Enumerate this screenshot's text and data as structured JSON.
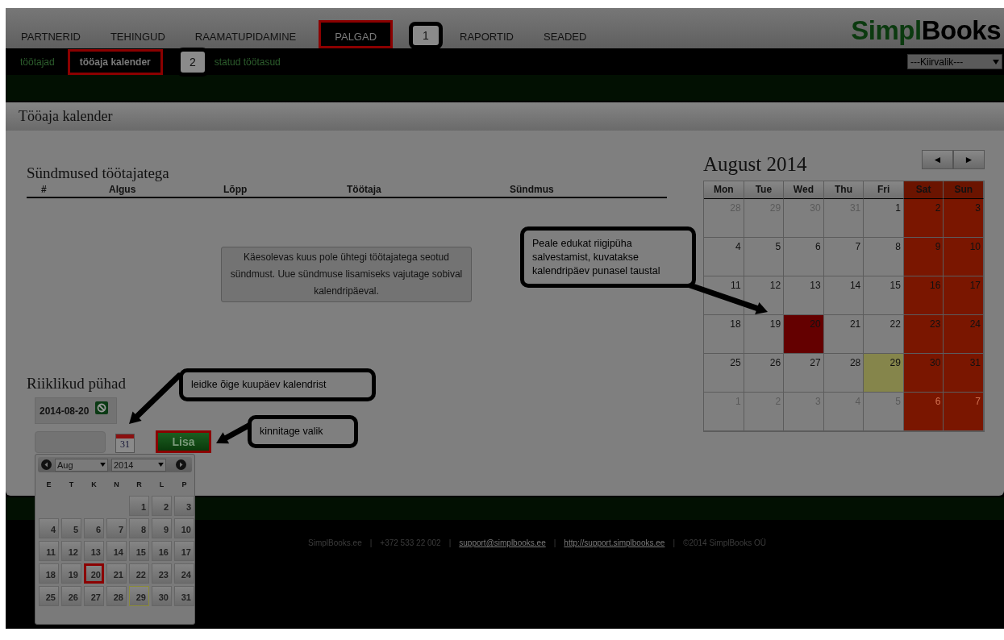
{
  "nav": {
    "items": [
      {
        "label": "PARTNERID",
        "selected": false,
        "highlighted": false
      },
      {
        "label": "TEHINGUD",
        "selected": false,
        "highlighted": false
      },
      {
        "label": "RAAMATUPIDAMINE",
        "selected": false,
        "highlighted": false
      },
      {
        "label": "PALGAD",
        "selected": true,
        "highlighted": true
      },
      {
        "label": "RAPORTID",
        "selected": false,
        "highlighted": false
      },
      {
        "label": "SEADED",
        "selected": false,
        "highlighted": false
      }
    ],
    "logo": [
      "Simpl",
      "Books"
    ]
  },
  "subnav": {
    "items": [
      {
        "label": "töötajad",
        "selected": false,
        "highlighted": false
      },
      {
        "label": "tööaja kalender",
        "selected": true,
        "highlighted": true
      },
      {
        "label": "statud töötasud",
        "selected": false,
        "highlighted": false
      }
    ],
    "quick_select": "---Kiirvalik---"
  },
  "page_title": "Tööaja kalender",
  "events": {
    "title": "Sündmused töötajatega",
    "columns": [
      "#",
      "Algus",
      "Lõpp",
      "Töötaja",
      "Sündmus"
    ],
    "notice": "Käesolevas kuus pole ühtegi töötajatega seotud sündmust. Uue sündmuse lisamiseks vajutage sobival kalendripäeval."
  },
  "holidays": {
    "title": "Riiklikud pühad",
    "dates": [
      "2014-08-20"
    ],
    "add_button": {
      "label": "Lisa",
      "highlighted": true
    },
    "calendar_icon_day": "31"
  },
  "datepicker": {
    "month": "Aug",
    "year": "2014",
    "weekdays": [
      "E",
      "T",
      "K",
      "N",
      "R",
      "L",
      "P"
    ],
    "weeks": [
      [
        {
          "kind": "empty"
        },
        {
          "kind": "empty"
        },
        {
          "kind": "empty"
        },
        {
          "kind": "empty"
        },
        {
          "day": "1",
          "kind": "day"
        },
        {
          "day": "2",
          "kind": "day"
        },
        {
          "day": "3",
          "kind": "day"
        }
      ],
      [
        {
          "day": "4",
          "kind": "day"
        },
        {
          "day": "5",
          "kind": "day"
        },
        {
          "day": "6",
          "kind": "day"
        },
        {
          "day": "7",
          "kind": "day"
        },
        {
          "day": "8",
          "kind": "day"
        },
        {
          "day": "9",
          "kind": "day"
        },
        {
          "day": "10",
          "kind": "day"
        }
      ],
      [
        {
          "day": "11",
          "kind": "day"
        },
        {
          "day": "12",
          "kind": "day"
        },
        {
          "day": "13",
          "kind": "day"
        },
        {
          "day": "14",
          "kind": "day"
        },
        {
          "day": "15",
          "kind": "day"
        },
        {
          "day": "16",
          "kind": "day"
        },
        {
          "day": "17",
          "kind": "day"
        }
      ],
      [
        {
          "day": "18",
          "kind": "day"
        },
        {
          "day": "19",
          "kind": "day"
        },
        {
          "day": "20",
          "kind": "highlighted"
        },
        {
          "day": "21",
          "kind": "day"
        },
        {
          "day": "22",
          "kind": "day"
        },
        {
          "day": "23",
          "kind": "day"
        },
        {
          "day": "24",
          "kind": "day"
        }
      ],
      [
        {
          "day": "25",
          "kind": "day"
        },
        {
          "day": "26",
          "kind": "day"
        },
        {
          "day": "27",
          "kind": "day"
        },
        {
          "day": "28",
          "kind": "day"
        },
        {
          "day": "29",
          "kind": "today"
        },
        {
          "day": "30",
          "kind": "day"
        },
        {
          "day": "31",
          "kind": "day"
        }
      ]
    ]
  },
  "calendar": {
    "title": "August 2014",
    "prev": "◄",
    "next": "►",
    "headers": [
      {
        "label": "Mon",
        "weekend": false
      },
      {
        "label": "Tue",
        "weekend": false
      },
      {
        "label": "Wed",
        "weekend": false
      },
      {
        "label": "Thu",
        "weekend": false
      },
      {
        "label": "Fri",
        "weekend": false
      },
      {
        "label": "Sat",
        "weekend": true
      },
      {
        "label": "Sun",
        "weekend": true
      }
    ],
    "weeks": [
      [
        {
          "day": "28",
          "kind": "weekday",
          "outside": true
        },
        {
          "day": "29",
          "kind": "weekday",
          "outside": true
        },
        {
          "day": "30",
          "kind": "weekday",
          "outside": true
        },
        {
          "day": "31",
          "kind": "weekday",
          "outside": true
        },
        {
          "day": "1",
          "kind": "weekday",
          "outside": false
        },
        {
          "day": "2",
          "kind": "weekend",
          "outside": false
        },
        {
          "day": "3",
          "kind": "weekend",
          "outside": false
        }
      ],
      [
        {
          "day": "4",
          "kind": "weekday",
          "outside": false
        },
        {
          "day": "5",
          "kind": "weekday",
          "outside": false
        },
        {
          "day": "6",
          "kind": "weekday",
          "outside": false
        },
        {
          "day": "7",
          "kind": "weekday",
          "outside": false
        },
        {
          "day": "8",
          "kind": "weekday",
          "outside": false
        },
        {
          "day": "9",
          "kind": "weekend",
          "outside": false
        },
        {
          "day": "10",
          "kind": "weekend",
          "outside": false
        }
      ],
      [
        {
          "day": "11",
          "kind": "weekday",
          "outside": false
        },
        {
          "day": "12",
          "kind": "weekday",
          "outside": false
        },
        {
          "day": "13",
          "kind": "weekday",
          "outside": false
        },
        {
          "day": "14",
          "kind": "weekday",
          "outside": false
        },
        {
          "day": "15",
          "kind": "weekday",
          "outside": false
        },
        {
          "day": "16",
          "kind": "weekend",
          "outside": false
        },
        {
          "day": "17",
          "kind": "weekend",
          "outside": false
        }
      ],
      [
        {
          "day": "18",
          "kind": "weekday",
          "outside": false
        },
        {
          "day": "19",
          "kind": "weekday",
          "outside": false
        },
        {
          "day": "20",
          "kind": "holiday",
          "outside": false
        },
        {
          "day": "21",
          "kind": "weekday",
          "outside": false
        },
        {
          "day": "22",
          "kind": "weekday",
          "outside": false
        },
        {
          "day": "23",
          "kind": "weekend",
          "outside": false
        },
        {
          "day": "24",
          "kind": "weekend",
          "outside": false
        }
      ],
      [
        {
          "day": "25",
          "kind": "weekday",
          "outside": false
        },
        {
          "day": "26",
          "kind": "weekday",
          "outside": false
        },
        {
          "day": "27",
          "kind": "weekday",
          "outside": false
        },
        {
          "day": "28",
          "kind": "weekday",
          "outside": false
        },
        {
          "day": "29",
          "kind": "today",
          "outside": false
        },
        {
          "day": "30",
          "kind": "weekend",
          "outside": false
        },
        {
          "day": "31",
          "kind": "weekend",
          "outside": false
        }
      ],
      [
        {
          "day": "1",
          "kind": "weekday",
          "outside": true
        },
        {
          "day": "2",
          "kind": "weekday",
          "outside": true
        },
        {
          "day": "3",
          "kind": "weekday",
          "outside": true
        },
        {
          "day": "4",
          "kind": "weekday",
          "outside": true
        },
        {
          "day": "5",
          "kind": "weekday",
          "outside": true
        },
        {
          "day": "6",
          "kind": "weekend",
          "outside": true
        },
        {
          "day": "7",
          "kind": "weekend",
          "outside": true
        }
      ]
    ]
  },
  "footer": [
    {
      "kind": "text",
      "text": "SimplBooks.ee"
    },
    {
      "kind": "separator",
      "text": "|"
    },
    {
      "kind": "text",
      "text": "+372 533 22 002"
    },
    {
      "kind": "separator",
      "text": "|"
    },
    {
      "kind": "link",
      "text": "support@simplbooks.ee"
    },
    {
      "kind": "separator",
      "text": "|"
    },
    {
      "kind": "link",
      "text": "http://support.simplbooks.ee"
    },
    {
      "kind": "separator",
      "text": "|"
    },
    {
      "kind": "text",
      "text": "©2014 SimplBooks OÜ"
    }
  ],
  "annotations": [
    {
      "kind": "badge",
      "text": "1"
    },
    {
      "kind": "badge",
      "text": "2"
    },
    {
      "kind": "callout",
      "text": "Peale edukat riigipüha salvestamist, kuvatakse kalendripäev punasel taustal"
    },
    {
      "kind": "callout",
      "text": "leidke õige kuupäev kalendrist"
    },
    {
      "kind": "callout",
      "text": "kinnitage valik"
    }
  ]
}
